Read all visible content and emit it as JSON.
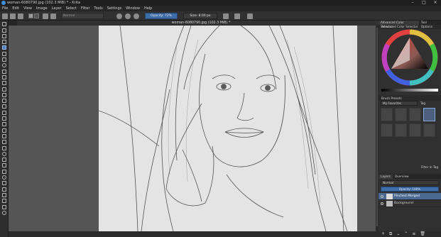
{
  "title": "woman-6080790.jpg (102.3 MiB) * - Krita",
  "menu": [
    "File",
    "Edit",
    "View",
    "Image",
    "Layer",
    "Select",
    "Filter",
    "Tools",
    "Settings",
    "Window",
    "Help"
  ],
  "toolbar": {
    "brush_search_placeholder": "Normal",
    "opacity_label": "Opacity: 72%",
    "size_label": "Size: 8.00 px"
  },
  "document_tab": "woman-6080790.jpg (102.3 MiB) *",
  "dockers": {
    "color_tabs": [
      "Advanced Color Selector",
      "Tool Options"
    ],
    "color_panel_title": "Advanced Color Selector",
    "brush_panel_title": "Brush Presets",
    "brush_tag": "My Favorites",
    "brush_tag_label": "Tag",
    "filter_tag_label": "Filter in Tag",
    "layers_tabs": [
      "Layers",
      "Overview"
    ],
    "layers_blend": "Normal",
    "layers_opacity": "Opacity: 100%",
    "layers": [
      {
        "name": "Pinched Merged",
        "selected": true
      },
      {
        "name": "Background",
        "selected": false
      }
    ]
  },
  "colors": {
    "accent": "#3e6eaa",
    "selection": "#4a6a92"
  }
}
